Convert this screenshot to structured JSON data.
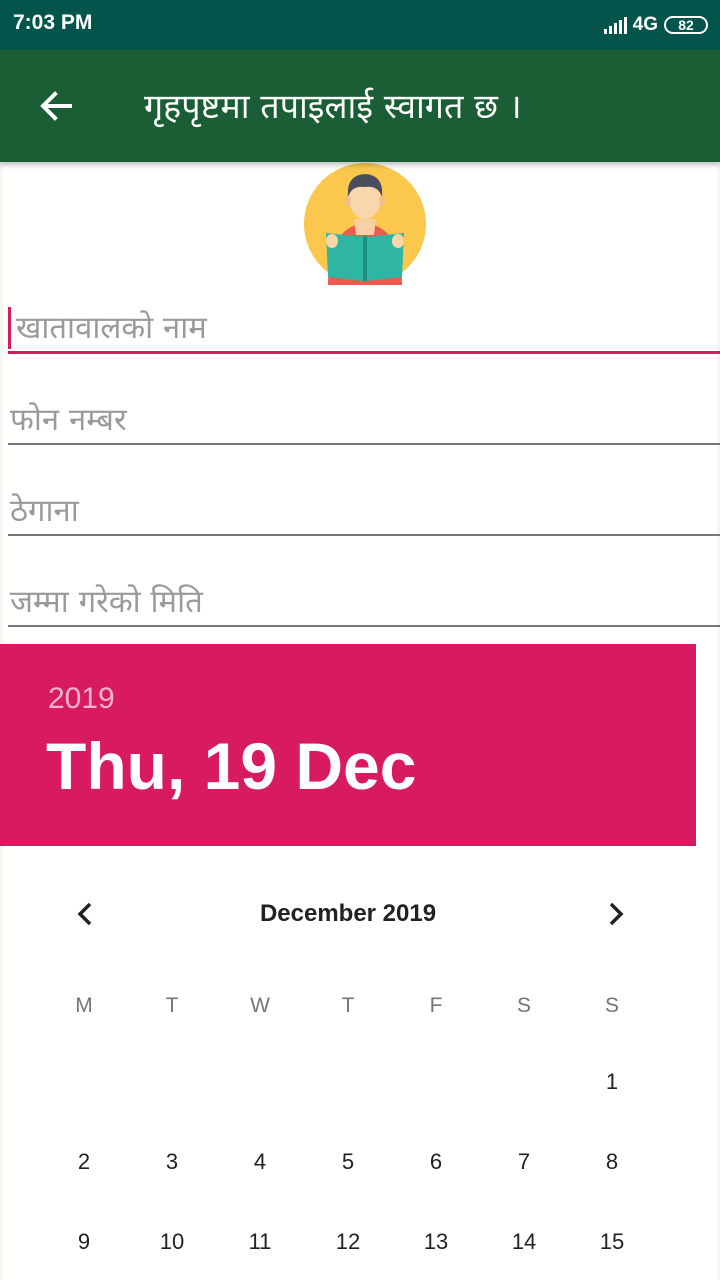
{
  "status_bar": {
    "time": "7:03 PM",
    "network": "4G",
    "battery": "82"
  },
  "app_bar": {
    "title": "गृहपृष्टमा तपाइलाई स्वागत छ ।",
    "back_icon": "arrow-back-icon"
  },
  "avatar": {
    "icon": "reader-avatar-icon"
  },
  "form": {
    "name_placeholder": "खातावालको नाम",
    "phone_placeholder": "फोन नम्बर",
    "address_placeholder": "ठेगाना",
    "date_placeholder": "जम्मा गरेको मिति"
  },
  "date_picker": {
    "year": "2019",
    "selected_date": "Thu, 19 Dec",
    "month_label": "December 2019",
    "weekdays": [
      "M",
      "T",
      "W",
      "T",
      "F",
      "S",
      "S"
    ],
    "weeks": [
      [
        "",
        "",
        "",
        "",
        "",
        "",
        "1"
      ],
      [
        "2",
        "3",
        "4",
        "5",
        "6",
        "7",
        "8"
      ],
      [
        "9",
        "10",
        "11",
        "12",
        "13",
        "14",
        "15"
      ]
    ],
    "colors": {
      "header": "#d81b60",
      "accent": "#d81b60"
    }
  },
  "colors": {
    "status_bar": "#03544a",
    "app_bar": "#1b5e35"
  }
}
